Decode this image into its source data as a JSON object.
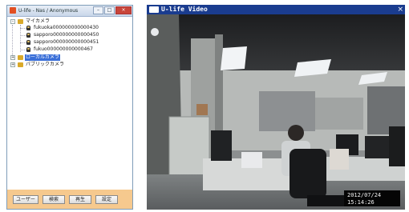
{
  "left_window": {
    "title": "U-life - Nas / Anonymous",
    "min_glyph": "–",
    "max_glyph": "□",
    "close_glyph": "×",
    "tree": {
      "root": {
        "toggle": "–",
        "label": "マイカメラ"
      },
      "cameras": [
        {
          "label": "fukuoka000000000000430"
        },
        {
          "label": "sapporo000000000000450"
        },
        {
          "label": "sapporo000000000000451"
        },
        {
          "label": "fukuo000000000000467"
        }
      ],
      "local": {
        "toggle": "+",
        "label": "ローカルカメラ"
      },
      "public": {
        "toggle": "+",
        "label": "パブリックカメラ"
      }
    },
    "buttons": {
      "user": "ユーザー",
      "search": "検索",
      "refresh": "再生",
      "settings": "設定"
    }
  },
  "right_window": {
    "title": "U-life Video",
    "close_glyph": "×",
    "osd_date": "2012/07/24",
    "osd_time": "15:14:26"
  },
  "colors": {
    "accent_orange": "#f6c98e",
    "selection_blue": "#3a6fd8",
    "titlebar_blue": "#1a3c8f"
  }
}
